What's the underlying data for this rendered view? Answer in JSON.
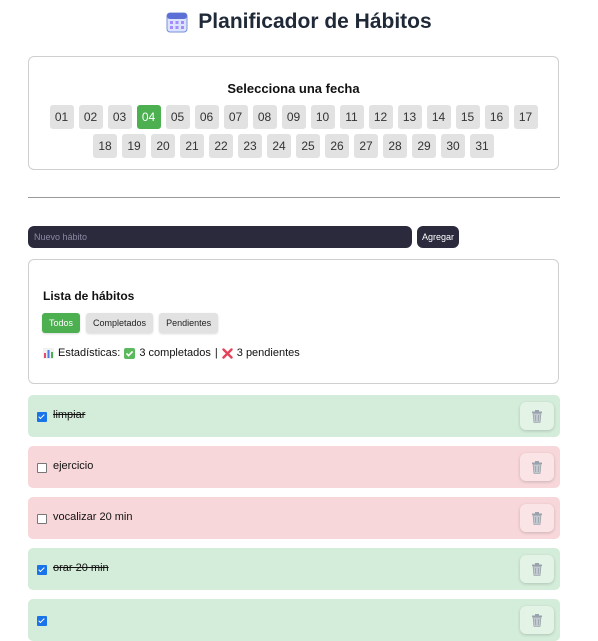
{
  "title": "Planificador de Hábitos",
  "date_selector": {
    "heading": "Selecciona una fecha",
    "days": [
      "01",
      "02",
      "03",
      "04",
      "05",
      "06",
      "07",
      "08",
      "09",
      "10",
      "11",
      "12",
      "13",
      "14",
      "15",
      "16",
      "17",
      "18",
      "19",
      "20",
      "21",
      "22",
      "23",
      "24",
      "25",
      "26",
      "27",
      "28",
      "29",
      "30",
      "31"
    ],
    "selected": "04"
  },
  "new_habit": {
    "placeholder": "Nuevo hábito",
    "add_label": "Agregar"
  },
  "habit_list": {
    "heading": "Lista de hábitos",
    "filters": [
      {
        "label": "Todos",
        "active": true
      },
      {
        "label": "Completados",
        "active": false
      },
      {
        "label": "Pendientes",
        "active": false
      }
    ],
    "stats": {
      "label": "Estadísticas:",
      "completed_text": "3 completados",
      "separator": "|",
      "pending_text": "3 pendientes"
    }
  },
  "habits": [
    {
      "name": "limpiar",
      "done": true
    },
    {
      "name": "ejercicio",
      "done": false
    },
    {
      "name": "vocalizar 20 min",
      "done": false
    },
    {
      "name": "orar 20 min",
      "done": true
    },
    {
      "name": "",
      "done": true
    }
  ],
  "colors": {
    "accent": "#4caf50",
    "done_bg": "#d4edda",
    "pending_bg": "#f8d7da",
    "input_bg": "#2b2a3d"
  }
}
